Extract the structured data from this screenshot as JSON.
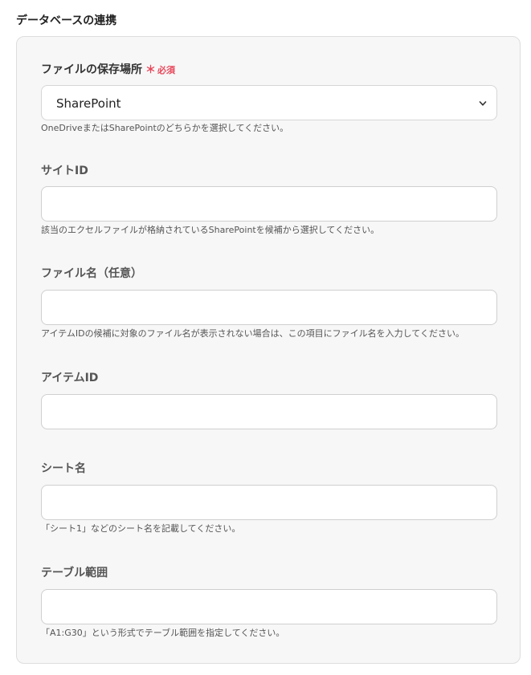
{
  "section_title": "データベースの連携",
  "fields": [
    {
      "label": "ファイルの保存場所",
      "required_mark": "＊",
      "required_text": "必須",
      "value": "SharePoint",
      "help": "OneDriveまたはSharePointのどちらかを選択してください。"
    },
    {
      "label": "サイトID",
      "value": "",
      "help": "該当のエクセルファイルが格納されているSharePointを候補から選択してください。"
    },
    {
      "label": "ファイル名（任意）",
      "value": "",
      "help": "アイテムIDの候補に対象のファイル名が表示されない場合は、この項目にファイル名を入力してください。"
    },
    {
      "label": "アイテムID",
      "value": ""
    },
    {
      "label": "シート名",
      "value": "",
      "help": "「シート1」などのシート名を記載してください。"
    },
    {
      "label": "テーブル範囲",
      "value": "",
      "help": "「A1:G30」という形式でテーブル範囲を指定してください。"
    }
  ],
  "colors": {
    "required": "#e8475a",
    "panel_bg": "#f7f7f7",
    "border": "#cfcfcf"
  },
  "icons": {
    "select": "chevron-down-icon"
  }
}
